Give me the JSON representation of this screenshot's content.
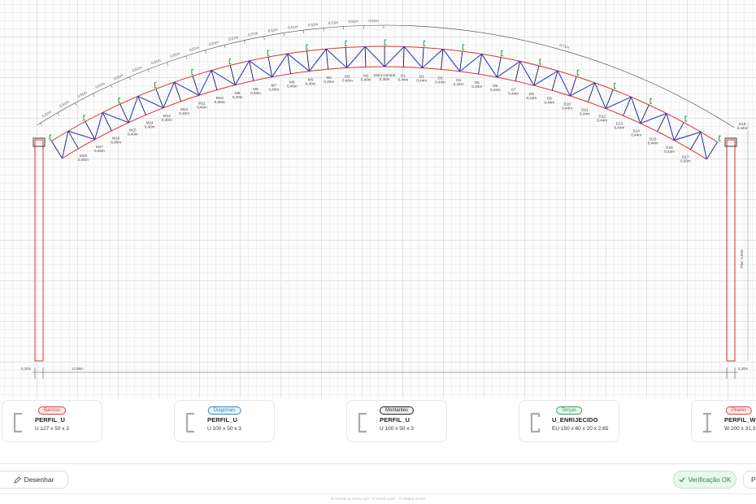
{
  "canvas": {
    "top_chord_length": "0,51m",
    "right_chord_length": "0,71m",
    "left_node_labels": [
      {
        "name": "M18",
        "len": "0,40m"
      },
      {
        "name": "M17",
        "len": "0,40m"
      },
      {
        "name": "M16",
        "len": "0,40m"
      },
      {
        "name": "M15",
        "len": "0,40m"
      },
      {
        "name": "M14",
        "len": "0,40m"
      },
      {
        "name": "M13",
        "len": "0,40m"
      },
      {
        "name": "M12",
        "len": "0,40m"
      },
      {
        "name": "M11",
        "len": "0,40m"
      },
      {
        "name": "M10",
        "len": "0,40m"
      },
      {
        "name": "M9",
        "len": "0,40m"
      },
      {
        "name": "M8",
        "len": "0,40m"
      },
      {
        "name": "M7",
        "len": "0,40m"
      },
      {
        "name": "M6",
        "len": "0,40m"
      },
      {
        "name": "M5",
        "len": "0,40m"
      },
      {
        "name": "M4",
        "len": "0,40m"
      },
      {
        "name": "M3",
        "len": "0,40m"
      },
      {
        "name": "M2",
        "len": "0,40m"
      }
    ],
    "center_label": {
      "name": "Mont Central",
      "len": "0,40m"
    },
    "right_node_labels": [
      {
        "name": "D1",
        "len": "0,44m"
      },
      {
        "name": "D2",
        "len": "0,44m"
      },
      {
        "name": "D3",
        "len": "0,44m"
      },
      {
        "name": "D4",
        "len": "0,44m"
      },
      {
        "name": "D5",
        "len": "0,44m"
      },
      {
        "name": "D6",
        "len": "0,44m"
      },
      {
        "name": "D7",
        "len": "0,44m"
      },
      {
        "name": "D8",
        "len": "0,44m"
      },
      {
        "name": "D9",
        "len": "0,44m"
      },
      {
        "name": "D10",
        "len": "0,44m"
      },
      {
        "name": "D11",
        "len": "0,44m"
      },
      {
        "name": "D12",
        "len": "0,44m"
      },
      {
        "name": "D13",
        "len": "0,44m"
      },
      {
        "name": "D14",
        "len": "0,44m"
      },
      {
        "name": "D15",
        "len": "0,44m"
      },
      {
        "name": "D16",
        "len": "0,44m"
      },
      {
        "name": "D17",
        "len": "0,50m"
      }
    ],
    "end_label": {
      "name": "D18",
      "len": "0,44m"
    },
    "pillar_height": "Pilar: 5,88m",
    "span_total": "14,98m",
    "left_offset": "0,30m",
    "right_offset": "0,30m"
  },
  "profiles": [
    {
      "tag": "Banzos",
      "name": "PERFIL_U",
      "spec": "U 127 x 50 x 3",
      "icon": "u-profile-icon",
      "color": "#e23c3c",
      "bg": "#fdeaea"
    },
    {
      "tag": "Diagonais",
      "name": "PERFIL_U",
      "spec": "U 100 x 50 x 3",
      "icon": "u-profile-icon",
      "color": "#2a8ad0",
      "bg": "#e7f3fc"
    },
    {
      "tag": "Montantes",
      "name": "PERFIL_U",
      "spec": "U 100 x 50 x 3",
      "icon": "u-profile-icon",
      "color": "#222222",
      "bg": "#eeeeee"
    },
    {
      "tag": "Terças",
      "name": "U_ENRIJECIDO",
      "spec": "EU 150 x 60 x 20 x 2,65",
      "icon": "u-stiffened-icon",
      "color": "#2aa35a",
      "bg": "#e6f6ec"
    },
    {
      "tag": "Pilares",
      "name": "PERFIL_W",
      "spec": "W 200 x 31,3",
      "icon": "w-profile-icon",
      "color": "#e23c3c",
      "bg": "#fdeaea"
    }
  ],
  "bottombar": {
    "draw_label": "Desenhar",
    "draw_icon": "pencil-icon",
    "verify_label": "Verificação OK",
    "verify_icon": "check-icon",
    "extra_label": "P"
  },
  "footer": "● Arraste no menu com · ↺ Scroll zoom · ⟳ Ataque mover"
}
